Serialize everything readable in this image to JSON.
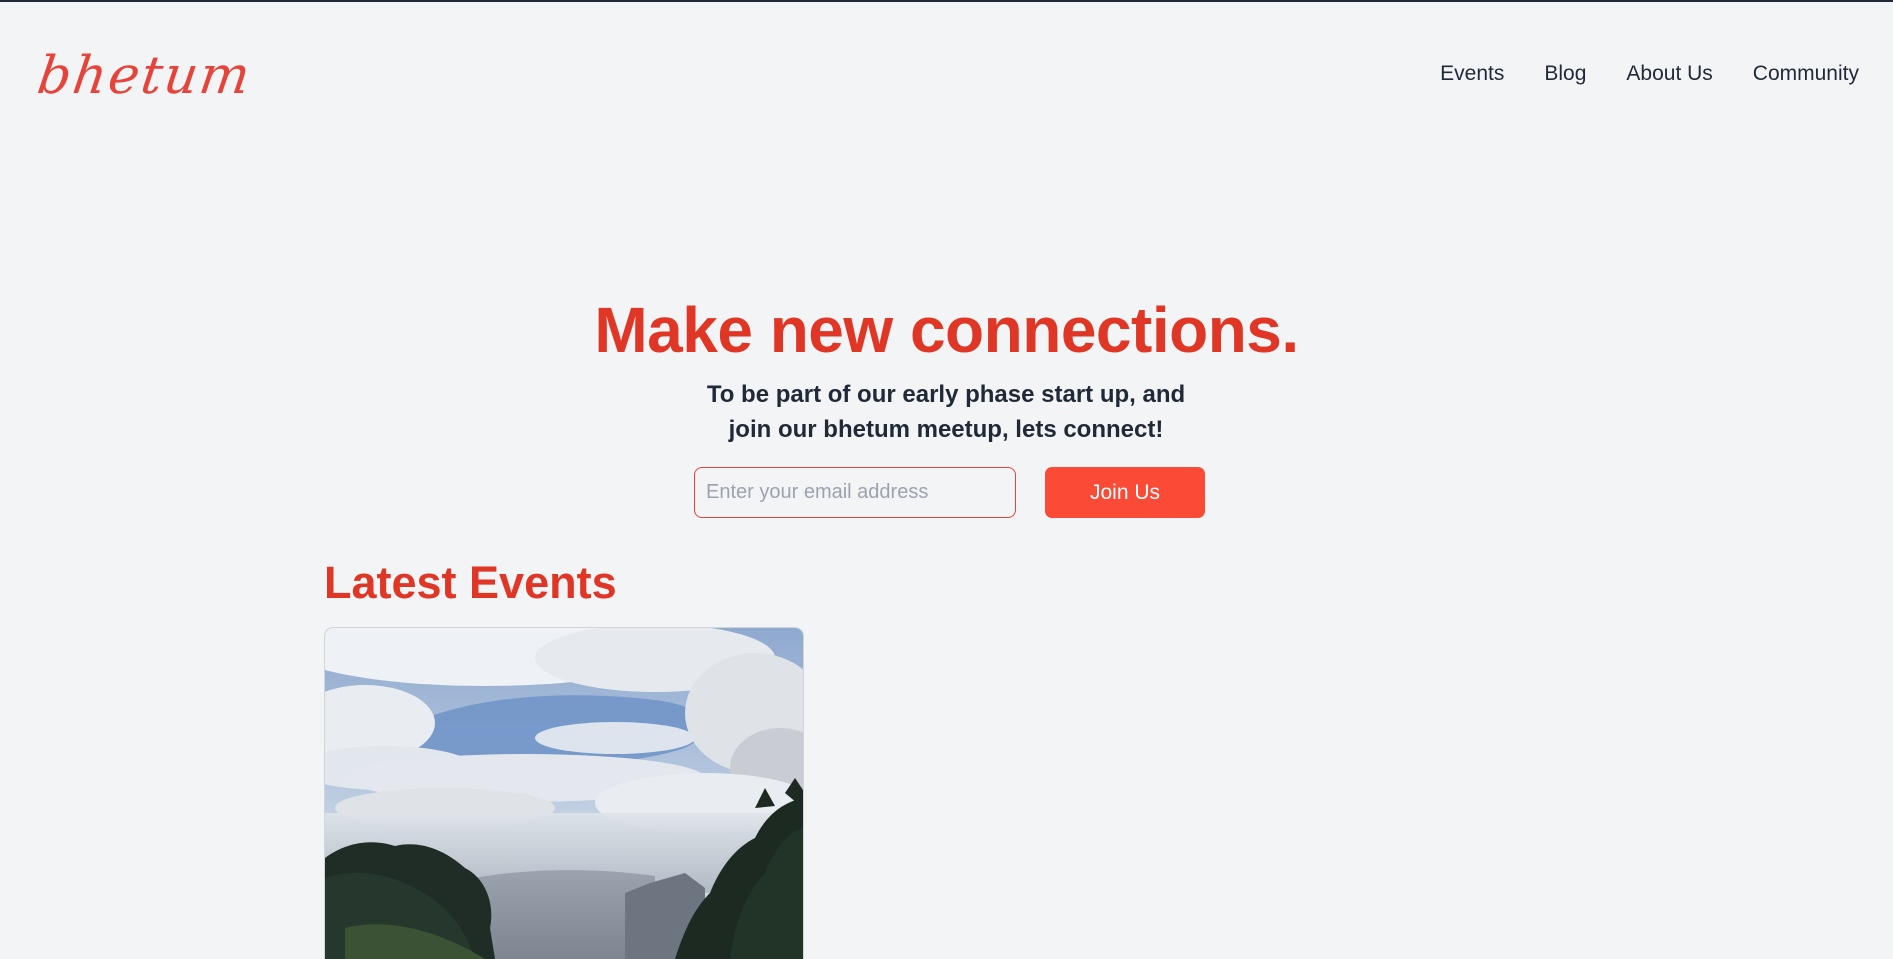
{
  "brand": {
    "logo_text": "bhetum",
    "accent_color": "#df3626",
    "button_color": "#fb4a36"
  },
  "nav": {
    "items": [
      {
        "label": "Events"
      },
      {
        "label": "Blog"
      },
      {
        "label": "About Us"
      },
      {
        "label": "Community"
      }
    ]
  },
  "hero": {
    "title": "Make new connections.",
    "subtitle": "To be part of our early phase start up, and join our bhetum meetup, lets connect!",
    "email_placeholder": "Enter your email address",
    "email_value": "",
    "join_label": "Join Us"
  },
  "events": {
    "section_title": "Latest Events",
    "cards": [
      {
        "image": "landscape-photo-sky-clouds-pine-trees-valley"
      }
    ]
  }
}
